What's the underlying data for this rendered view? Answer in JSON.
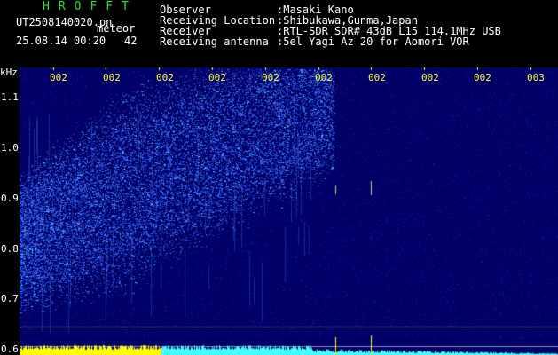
{
  "header": {
    "app_title": "HROFFT",
    "filename": "UT2508140020.pn",
    "file_tag": "meteor",
    "datetime": "25.08.14 00:20",
    "datetime_suffix": "42",
    "fields": [
      {
        "label": "Observer",
        "value": ":Masaki Kano"
      },
      {
        "label": "Receiving Location",
        "value": ":Shibukawa,Gunma,Japan"
      },
      {
        "label": "Receiver",
        "value": ":RTL-SDR SDR# 43dB L15 114.1MHz USB"
      },
      {
        "label": "Receiving antenna",
        "value": ":5el Yagi Az 20 for Aomori VOR"
      }
    ]
  },
  "spectrogram": {
    "unit_label": "kHz",
    "y_ticks": [
      "1.1",
      "1.0",
      "0.9",
      "0.8",
      "0.7",
      "0.6"
    ],
    "y_tick_values": [
      1.1,
      1.0,
      0.9,
      0.8,
      0.7,
      0.6
    ],
    "y_range": [
      0.59,
      1.16
    ],
    "x_ticks": [
      "002",
      "002",
      "002",
      "002",
      "002",
      "002",
      "002",
      "002",
      "002",
      "003"
    ],
    "colors": {
      "background": "#000066",
      "trace": "#3366ff",
      "bright": "#33ddff",
      "level_bar_yellow": "#ffff00",
      "level_bar_cyan": "#44ffff",
      "header_title": "#22e23a"
    }
  }
}
